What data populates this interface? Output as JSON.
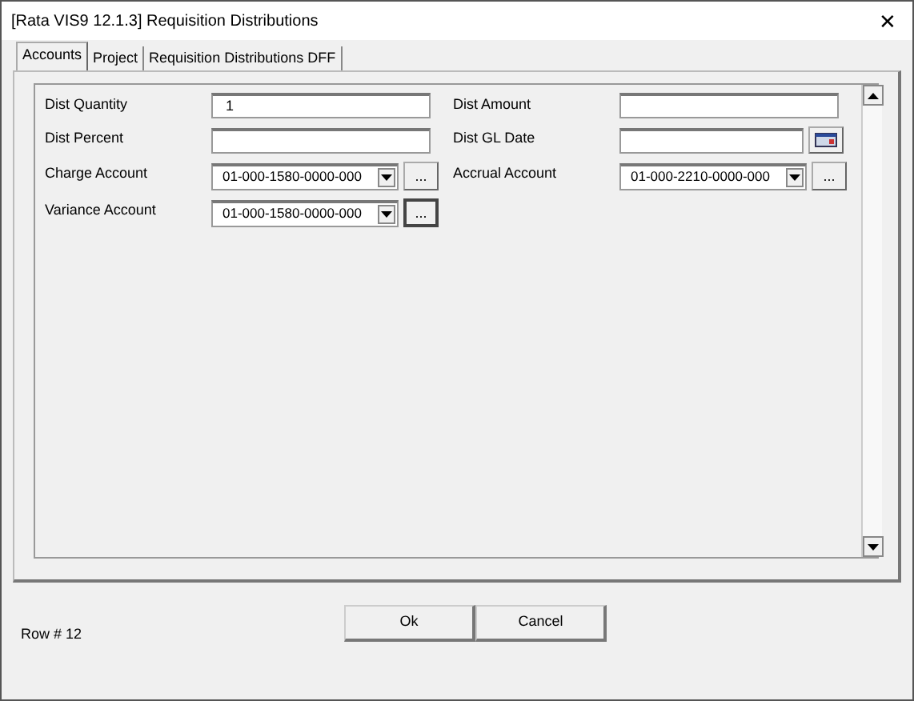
{
  "window": {
    "title": "[Rata VIS9 12.1.3] Requisition Distributions",
    "close": "✕"
  },
  "tabs": [
    {
      "label": "Accounts",
      "selected": true
    },
    {
      "label": "Project",
      "selected": false
    },
    {
      "label": "Requisition Distributions DFF",
      "selected": false
    }
  ],
  "fields": [
    {
      "label": "Dist Quantity",
      "kind": "text",
      "value": "1"
    },
    {
      "label": "Dist Amount",
      "kind": "text"
    },
    {
      "label": "Dist Percent",
      "kind": "text"
    },
    {
      "label": "Dist GL Date",
      "kind": "date"
    },
    {
      "label": "Charge Account",
      "kind": "combo",
      "value": "01-000-1580-0000-000",
      "lookup": "...",
      "focused": false
    },
    {
      "label": "Accrual Account",
      "kind": "combo",
      "value": "01-000-2210-0000-000",
      "lookup": "...",
      "focused": false
    },
    {
      "label": "Variance Account",
      "kind": "combo",
      "value": "01-000-1580-0000-000",
      "lookup": "...",
      "focused": true
    }
  ],
  "status": "Row # 12",
  "buttons": [
    "Ok",
    "Cancel"
  ]
}
